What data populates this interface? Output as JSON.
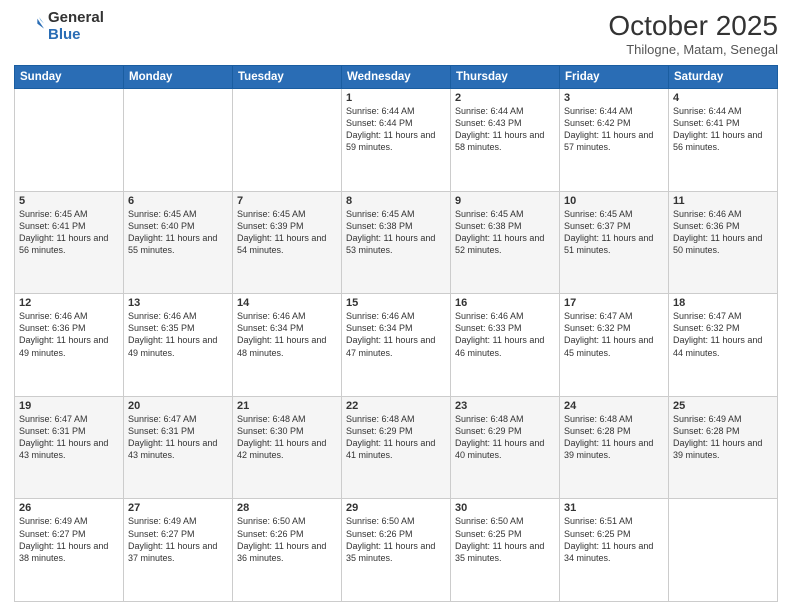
{
  "logo": {
    "general": "General",
    "blue": "Blue"
  },
  "header": {
    "month": "October 2025",
    "location": "Thilogne, Matam, Senegal"
  },
  "days_of_week": [
    "Sunday",
    "Monday",
    "Tuesday",
    "Wednesday",
    "Thursday",
    "Friday",
    "Saturday"
  ],
  "weeks": [
    [
      {
        "day": "",
        "info": ""
      },
      {
        "day": "",
        "info": ""
      },
      {
        "day": "",
        "info": ""
      },
      {
        "day": "1",
        "info": "Sunrise: 6:44 AM\nSunset: 6:44 PM\nDaylight: 11 hours and 59 minutes."
      },
      {
        "day": "2",
        "info": "Sunrise: 6:44 AM\nSunset: 6:43 PM\nDaylight: 11 hours and 58 minutes."
      },
      {
        "day": "3",
        "info": "Sunrise: 6:44 AM\nSunset: 6:42 PM\nDaylight: 11 hours and 57 minutes."
      },
      {
        "day": "4",
        "info": "Sunrise: 6:44 AM\nSunset: 6:41 PM\nDaylight: 11 hours and 56 minutes."
      }
    ],
    [
      {
        "day": "5",
        "info": "Sunrise: 6:45 AM\nSunset: 6:41 PM\nDaylight: 11 hours and 56 minutes."
      },
      {
        "day": "6",
        "info": "Sunrise: 6:45 AM\nSunset: 6:40 PM\nDaylight: 11 hours and 55 minutes."
      },
      {
        "day": "7",
        "info": "Sunrise: 6:45 AM\nSunset: 6:39 PM\nDaylight: 11 hours and 54 minutes."
      },
      {
        "day": "8",
        "info": "Sunrise: 6:45 AM\nSunset: 6:38 PM\nDaylight: 11 hours and 53 minutes."
      },
      {
        "day": "9",
        "info": "Sunrise: 6:45 AM\nSunset: 6:38 PM\nDaylight: 11 hours and 52 minutes."
      },
      {
        "day": "10",
        "info": "Sunrise: 6:45 AM\nSunset: 6:37 PM\nDaylight: 11 hours and 51 minutes."
      },
      {
        "day": "11",
        "info": "Sunrise: 6:46 AM\nSunset: 6:36 PM\nDaylight: 11 hours and 50 minutes."
      }
    ],
    [
      {
        "day": "12",
        "info": "Sunrise: 6:46 AM\nSunset: 6:36 PM\nDaylight: 11 hours and 49 minutes."
      },
      {
        "day": "13",
        "info": "Sunrise: 6:46 AM\nSunset: 6:35 PM\nDaylight: 11 hours and 49 minutes."
      },
      {
        "day": "14",
        "info": "Sunrise: 6:46 AM\nSunset: 6:34 PM\nDaylight: 11 hours and 48 minutes."
      },
      {
        "day": "15",
        "info": "Sunrise: 6:46 AM\nSunset: 6:34 PM\nDaylight: 11 hours and 47 minutes."
      },
      {
        "day": "16",
        "info": "Sunrise: 6:46 AM\nSunset: 6:33 PM\nDaylight: 11 hours and 46 minutes."
      },
      {
        "day": "17",
        "info": "Sunrise: 6:47 AM\nSunset: 6:32 PM\nDaylight: 11 hours and 45 minutes."
      },
      {
        "day": "18",
        "info": "Sunrise: 6:47 AM\nSunset: 6:32 PM\nDaylight: 11 hours and 44 minutes."
      }
    ],
    [
      {
        "day": "19",
        "info": "Sunrise: 6:47 AM\nSunset: 6:31 PM\nDaylight: 11 hours and 43 minutes."
      },
      {
        "day": "20",
        "info": "Sunrise: 6:47 AM\nSunset: 6:31 PM\nDaylight: 11 hours and 43 minutes."
      },
      {
        "day": "21",
        "info": "Sunrise: 6:48 AM\nSunset: 6:30 PM\nDaylight: 11 hours and 42 minutes."
      },
      {
        "day": "22",
        "info": "Sunrise: 6:48 AM\nSunset: 6:29 PM\nDaylight: 11 hours and 41 minutes."
      },
      {
        "day": "23",
        "info": "Sunrise: 6:48 AM\nSunset: 6:29 PM\nDaylight: 11 hours and 40 minutes."
      },
      {
        "day": "24",
        "info": "Sunrise: 6:48 AM\nSunset: 6:28 PM\nDaylight: 11 hours and 39 minutes."
      },
      {
        "day": "25",
        "info": "Sunrise: 6:49 AM\nSunset: 6:28 PM\nDaylight: 11 hours and 39 minutes."
      }
    ],
    [
      {
        "day": "26",
        "info": "Sunrise: 6:49 AM\nSunset: 6:27 PM\nDaylight: 11 hours and 38 minutes."
      },
      {
        "day": "27",
        "info": "Sunrise: 6:49 AM\nSunset: 6:27 PM\nDaylight: 11 hours and 37 minutes."
      },
      {
        "day": "28",
        "info": "Sunrise: 6:50 AM\nSunset: 6:26 PM\nDaylight: 11 hours and 36 minutes."
      },
      {
        "day": "29",
        "info": "Sunrise: 6:50 AM\nSunset: 6:26 PM\nDaylight: 11 hours and 35 minutes."
      },
      {
        "day": "30",
        "info": "Sunrise: 6:50 AM\nSunset: 6:25 PM\nDaylight: 11 hours and 35 minutes."
      },
      {
        "day": "31",
        "info": "Sunrise: 6:51 AM\nSunset: 6:25 PM\nDaylight: 11 hours and 34 minutes."
      },
      {
        "day": "",
        "info": ""
      }
    ]
  ]
}
